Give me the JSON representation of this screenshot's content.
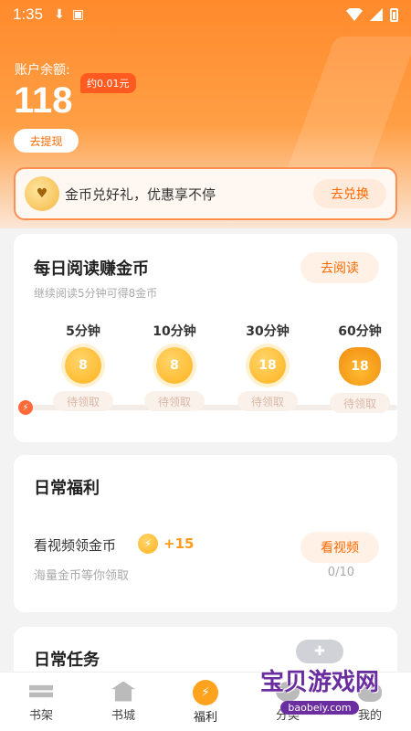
{
  "status_bar": {
    "time": "1:35",
    "icons": [
      "download-icon",
      "a-icon",
      "wifi-icon",
      "signal-icon",
      "battery-icon"
    ]
  },
  "account": {
    "balance_label": "账户余额:",
    "balance": "118",
    "approx_value": "约0.01元",
    "withdraw_label": "去提现"
  },
  "exchange_banner": {
    "text": "金币兑好礼，优惠享不停",
    "button": "去兑换"
  },
  "daily_read": {
    "title": "每日阅读赚金币",
    "subtitle": "继续阅读5分钟可得8金币",
    "button": "去阅读",
    "milestones": [
      {
        "minutes": "5分钟",
        "coins": "8",
        "status": "待领取"
      },
      {
        "minutes": "10分钟",
        "coins": "8",
        "status": "待领取"
      },
      {
        "minutes": "30分钟",
        "coins": "18",
        "status": "待领取"
      },
      {
        "minutes": "60分钟",
        "coins": "18",
        "status": "待领取"
      }
    ]
  },
  "daily_welfare": {
    "title": "日常福利",
    "task_name": "看视频领金币",
    "reward": "+15",
    "description": "海量金币等你领取",
    "button": "看视频",
    "progress": "0/10"
  },
  "daily_tasks": {
    "title": "日常任务"
  },
  "tabbar": {
    "tabs": [
      {
        "label": "书架",
        "icon": "bookshelf-icon"
      },
      {
        "label": "书城",
        "icon": "store-icon"
      },
      {
        "label": "福利",
        "icon": "welfare-icon"
      },
      {
        "label": "分类",
        "icon": "discover-icon"
      },
      {
        "label": "我的",
        "icon": "profile-icon"
      }
    ],
    "active": "福利"
  },
  "watermark": {
    "text": "宝贝游戏网",
    "url": "baobeiy.com"
  },
  "colors": {
    "accent": "#ff6a00",
    "hero_top": "#ff8a2c",
    "coin": "#ffb21e"
  }
}
